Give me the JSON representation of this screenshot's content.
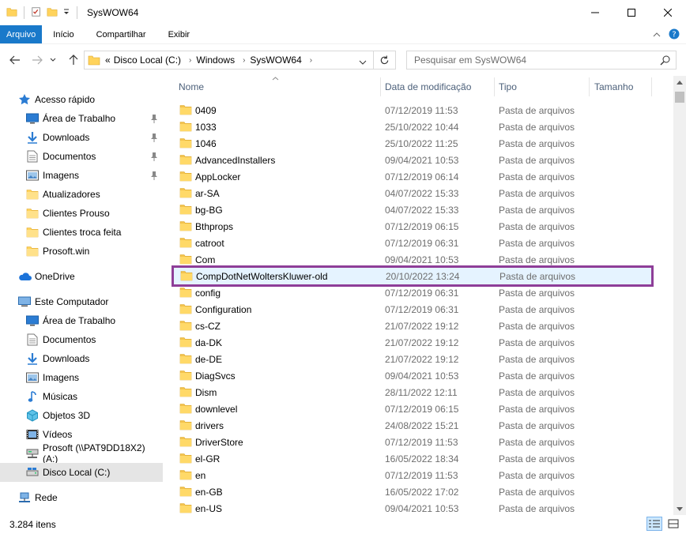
{
  "window": {
    "title": "SysWOW64"
  },
  "ribbon": {
    "tabs": [
      {
        "label": "Arquivo",
        "active": true
      },
      {
        "label": "Início"
      },
      {
        "label": "Compartilhar"
      },
      {
        "label": "Exibir"
      }
    ]
  },
  "address": {
    "prefix": "«",
    "crumbs": [
      "Disco Local (C:)",
      "Windows",
      "SysWOW64"
    ],
    "search_placeholder": "Pesquisar em SysWOW64"
  },
  "nav": {
    "items": [
      {
        "label": "Acesso rápido",
        "icon": "star-icon",
        "indent": 1,
        "pin": false
      },
      {
        "label": "Área de Trabalho",
        "icon": "desktop-icon",
        "indent": 2,
        "pin": true
      },
      {
        "label": "Downloads",
        "icon": "download-icon",
        "indent": 2,
        "pin": true
      },
      {
        "label": "Documentos",
        "icon": "document-icon",
        "indent": 2,
        "pin": true
      },
      {
        "label": "Imagens",
        "icon": "pictures-icon",
        "indent": 2,
        "pin": true
      },
      {
        "label": "Atualizadores",
        "icon": "folder-icon",
        "indent": 2,
        "pin": false
      },
      {
        "label": "Clientes Prouso",
        "icon": "folder-icon",
        "indent": 2,
        "pin": false
      },
      {
        "label": "Clientes troca feita",
        "icon": "folder-icon",
        "indent": 2,
        "pin": false
      },
      {
        "label": "Prosoft.win",
        "icon": "folder-icon",
        "indent": 2,
        "pin": false
      },
      {
        "label": "OneDrive",
        "icon": "cloud-icon",
        "indent": 1,
        "pin": false
      },
      {
        "label": "Este Computador",
        "icon": "computer-icon",
        "indent": 1,
        "pin": false
      },
      {
        "label": "Área de Trabalho",
        "icon": "desktop-icon",
        "indent": 2,
        "pin": false
      },
      {
        "label": "Documentos",
        "icon": "document-icon",
        "indent": 2,
        "pin": false
      },
      {
        "label": "Downloads",
        "icon": "download-icon",
        "indent": 2,
        "pin": false
      },
      {
        "label": "Imagens",
        "icon": "pictures-icon",
        "indent": 2,
        "pin": false
      },
      {
        "label": "Músicas",
        "icon": "music-icon",
        "indent": 2,
        "pin": false
      },
      {
        "label": "Objetos 3D",
        "icon": "cube-icon",
        "indent": 2,
        "pin": false
      },
      {
        "label": "Vídeos",
        "icon": "video-icon",
        "indent": 2,
        "pin": false
      },
      {
        "label": "Prosoft (\\\\PAT9DD18X2) (A:)",
        "icon": "network-drive-icon",
        "indent": 2,
        "pin": false
      },
      {
        "label": "Disco Local (C:)",
        "icon": "disk-icon",
        "indent": 2,
        "pin": false,
        "selected": true
      },
      {
        "label": "Rede",
        "icon": "network-icon",
        "indent": 1,
        "pin": false
      }
    ]
  },
  "columns": {
    "name": "Nome",
    "date": "Data de modificação",
    "type": "Tipo",
    "size": "Tamanho"
  },
  "files": [
    {
      "name": "0409",
      "date": "07/12/2019 11:53",
      "type": "Pasta de arquivos"
    },
    {
      "name": "1033",
      "date": "25/10/2022 10:44",
      "type": "Pasta de arquivos"
    },
    {
      "name": "1046",
      "date": "25/10/2022 11:25",
      "type": "Pasta de arquivos"
    },
    {
      "name": "AdvancedInstallers",
      "date": "09/04/2021 10:53",
      "type": "Pasta de arquivos"
    },
    {
      "name": "AppLocker",
      "date": "07/12/2019 06:14",
      "type": "Pasta de arquivos"
    },
    {
      "name": "ar-SA",
      "date": "04/07/2022 15:33",
      "type": "Pasta de arquivos"
    },
    {
      "name": "bg-BG",
      "date": "04/07/2022 15:33",
      "type": "Pasta de arquivos"
    },
    {
      "name": "Bthprops",
      "date": "07/12/2019 06:15",
      "type": "Pasta de arquivos"
    },
    {
      "name": "catroot",
      "date": "07/12/2019 06:31",
      "type": "Pasta de arquivos"
    },
    {
      "name": "Com",
      "date": "09/04/2021 10:53",
      "type": "Pasta de arquivos"
    },
    {
      "name": "CompDotNetWoltersKluwer-old",
      "date": "20/10/2022 13:24",
      "type": "Pasta de arquivos",
      "highlight": true
    },
    {
      "name": "config",
      "date": "07/12/2019 06:31",
      "type": "Pasta de arquivos"
    },
    {
      "name": "Configuration",
      "date": "07/12/2019 06:31",
      "type": "Pasta de arquivos"
    },
    {
      "name": "cs-CZ",
      "date": "21/07/2022 19:12",
      "type": "Pasta de arquivos"
    },
    {
      "name": "da-DK",
      "date": "21/07/2022 19:12",
      "type": "Pasta de arquivos"
    },
    {
      "name": "de-DE",
      "date": "21/07/2022 19:12",
      "type": "Pasta de arquivos"
    },
    {
      "name": "DiagSvcs",
      "date": "09/04/2021 10:53",
      "type": "Pasta de arquivos"
    },
    {
      "name": "Dism",
      "date": "28/11/2022 12:11",
      "type": "Pasta de arquivos"
    },
    {
      "name": "downlevel",
      "date": "07/12/2019 06:15",
      "type": "Pasta de arquivos"
    },
    {
      "name": "drivers",
      "date": "24/08/2022 15:21",
      "type": "Pasta de arquivos"
    },
    {
      "name": "DriverStore",
      "date": "07/12/2019 11:53",
      "type": "Pasta de arquivos"
    },
    {
      "name": "el-GR",
      "date": "16/05/2022 18:34",
      "type": "Pasta de arquivos"
    },
    {
      "name": "en",
      "date": "07/12/2019 11:53",
      "type": "Pasta de arquivos"
    },
    {
      "name": "en-GB",
      "date": "16/05/2022 17:02",
      "type": "Pasta de arquivos"
    },
    {
      "name": "en-US",
      "date": "09/04/2021 10:53",
      "type": "Pasta de arquivos"
    }
  ],
  "status": {
    "count": "3.284 itens"
  },
  "colors": {
    "accent": "#1979ca",
    "highlight_outline": "#8e3e98",
    "folder": "#ffd35c"
  }
}
